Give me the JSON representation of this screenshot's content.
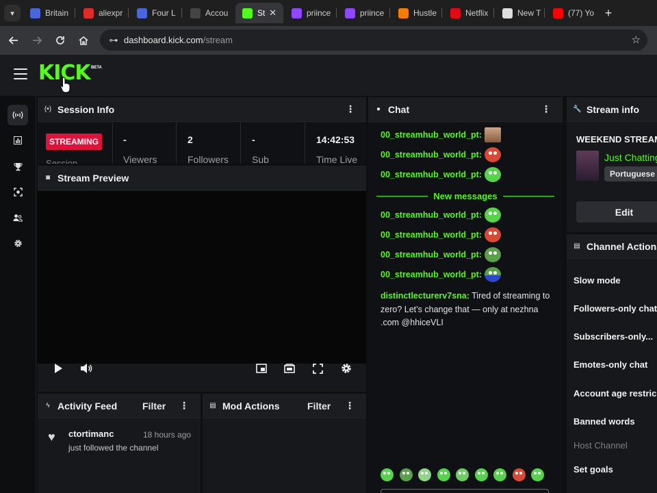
{
  "browser": {
    "tabs": [
      {
        "label": "Britain",
        "favicon": "app-icon",
        "color": "#4a66d9"
      },
      {
        "label": "aliexpr",
        "favicon": "cart-icon",
        "color": "#e02b2b"
      },
      {
        "label": "Four L",
        "favicon": "app-icon",
        "color": "#4a66d9"
      },
      {
        "label": "Accou",
        "favicon": "fn-icon",
        "color": "#444444"
      },
      {
        "label": "St",
        "favicon": "kick-icon",
        "color": "#53fc18",
        "active": true
      },
      {
        "label": "priince",
        "favicon": "twitch-icon",
        "color": "#9147ff"
      },
      {
        "label": "priince",
        "favicon": "twitch-icon",
        "color": "#9147ff"
      },
      {
        "label": "Hustle",
        "favicon": "blogger-icon",
        "color": "#f57d00"
      },
      {
        "label": "Netflix",
        "favicon": "netflix-icon",
        "color": "#e50914"
      },
      {
        "label": "New T",
        "favicon": "chrome-icon",
        "color": "#dddddd"
      },
      {
        "label": "(77) Yo",
        "favicon": "youtube-icon",
        "color": "#ff0000"
      }
    ],
    "url_host": "dashboard.kick.com",
    "url_path": "/stream"
  },
  "app": {
    "logo": "KICK",
    "beta": "BETA",
    "accent": "#53fc18"
  },
  "sidebar": {
    "items": [
      {
        "name": "broadcast-icon",
        "glyph": "(•)"
      },
      {
        "name": "chart-icon",
        "glyph": "▥"
      },
      {
        "name": "trophy-icon",
        "glyph": "🏆"
      },
      {
        "name": "camera-icon",
        "glyph": "◙"
      },
      {
        "name": "users-icon",
        "glyph": "👥"
      },
      {
        "name": "gear-icon",
        "glyph": "⚙"
      }
    ]
  },
  "session": {
    "title": "Session Info",
    "status": "STREAMING",
    "session_label": "Session",
    "stats": [
      {
        "value": "-",
        "label": "Viewers"
      },
      {
        "value": "2",
        "label": "Followers"
      },
      {
        "value": "-",
        "label": "Sub"
      },
      {
        "value": "14:42:53",
        "label": "Time Live"
      }
    ]
  },
  "preview": {
    "title": "Stream Preview"
  },
  "activity": {
    "title": "Activity Feed",
    "filter": "Filter",
    "items": [
      {
        "user": "ctortimanc",
        "time": "18 hours ago",
        "text": "just followed the channel"
      }
    ]
  },
  "mod": {
    "title": "Mod Actions",
    "filter": "Filter"
  },
  "chat": {
    "title": "Chat",
    "messages_before": [
      {
        "user": "00_streamhub_world_pt:",
        "emote": "photo"
      },
      {
        "user": "00_streamhub_world_pt:",
        "emote": "red"
      },
      {
        "user": "00_streamhub_world_pt:",
        "emote": "green"
      }
    ],
    "divider": "New messages",
    "messages_after": [
      {
        "user": "00_streamhub_world_pt:",
        "emote": "green"
      },
      {
        "user": "00_streamhub_world_pt:",
        "emote": "red"
      },
      {
        "user": "00_streamhub_world_pt:",
        "emote": "green"
      },
      {
        "user": "00_streamhub_world_pt:",
        "emote": "blue"
      }
    ],
    "long_message": {
      "user": "distinctlecturerv7sna:",
      "text": " Tired of streaming to zero? Let’s change that — only at nezhna .com @hhiceVLI"
    }
  },
  "stream_info": {
    "title": "Stream info",
    "stream_title": "WEEKEND STREAM",
    "category": "Just Chatting",
    "language": "Portuguese",
    "edit": "Edit"
  },
  "channel_actions": {
    "title": "Channel Actions",
    "items": [
      {
        "label": "Slow mode",
        "enabled": true
      },
      {
        "label": "Followers-only chat",
        "enabled": true
      },
      {
        "label": "Subscribers-only...",
        "enabled": true
      },
      {
        "label": "Emotes-only chat",
        "enabled": true
      },
      {
        "label": "Account age restric",
        "enabled": true
      },
      {
        "label": "Banned words",
        "enabled": true
      },
      {
        "label": "Host Channel",
        "enabled": false
      },
      {
        "label": "Set goals",
        "enabled": true
      }
    ]
  }
}
